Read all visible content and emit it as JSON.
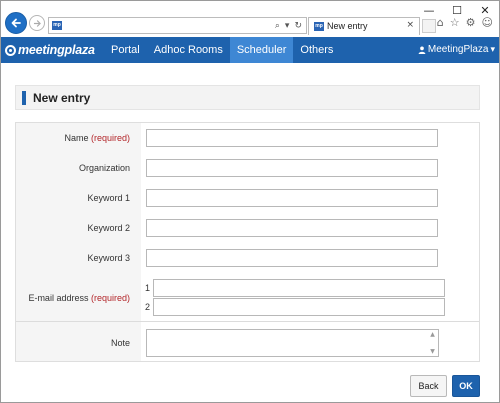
{
  "browser": {
    "address_value": "",
    "favicon_text": "mp",
    "tab_title": "New entry",
    "tab_close_glyph": "×",
    "win_minimize": "—",
    "win_maximize": "☐",
    "win_close": "✕",
    "address_tools": [
      "⌕",
      "▾",
      "↻"
    ],
    "toolbar_icons": [
      "⌂",
      "☆",
      "⚙",
      "☺"
    ],
    "icons": [
      "back-arrow-icon",
      "forward-arrow-icon",
      "search-icon",
      "refresh-icon",
      "home-icon",
      "favorites-star-icon",
      "settings-gear-icon",
      "smiley-feedback-icon"
    ]
  },
  "nav": {
    "logo": "meetingplaza",
    "items": [
      {
        "label": "Portal",
        "active": false
      },
      {
        "label": "Adhoc Rooms",
        "active": false
      },
      {
        "label": "Scheduler",
        "active": true
      },
      {
        "label": "Others",
        "active": false
      }
    ],
    "user": {
      "icon": "user-icon",
      "name": "MeetingPlaza",
      "caret": "▾"
    },
    "colors": {
      "bar": "#1e62ad",
      "active": "#3e87d4"
    }
  },
  "page": {
    "title": "New entry"
  },
  "form": {
    "required_text": "(required)",
    "required_color": "#b3262a",
    "fields": [
      {
        "label": "Name",
        "required": true,
        "value": ""
      },
      {
        "label": "Organization",
        "required": false,
        "value": ""
      },
      {
        "label": "Keyword 1",
        "required": false,
        "value": ""
      },
      {
        "label": "Keyword 2",
        "required": false,
        "value": ""
      },
      {
        "label": "Keyword 3",
        "required": false,
        "value": ""
      }
    ],
    "email": {
      "label": "E-mail address",
      "required": true,
      "entries": [
        {
          "num": "1",
          "value": ""
        },
        {
          "num": "2",
          "value": ""
        }
      ]
    },
    "note": {
      "label": "Note",
      "value": ""
    }
  },
  "buttons": {
    "back": "Back",
    "ok": "OK"
  }
}
